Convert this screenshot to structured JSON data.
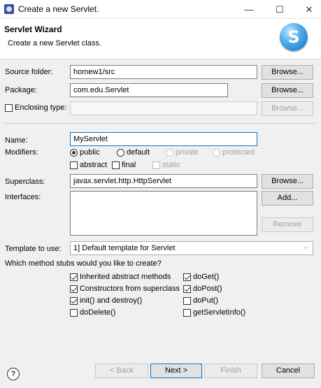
{
  "window": {
    "title": "Create a new Servlet.",
    "minimize": "—",
    "maximize": "☐",
    "close": "✕"
  },
  "header": {
    "title": "Servlet Wizard",
    "subtitle": "Create a new Servlet class.",
    "logo_letter": "S"
  },
  "form": {
    "source_folder": {
      "label": "Source folder:",
      "value": "homew1/src",
      "browse": "Browse..."
    },
    "package": {
      "label": "Package:",
      "value": "com.edu.Servlet",
      "browse": "Browse..."
    },
    "enclosing_type": {
      "label": "Enclosing type:",
      "value": "",
      "browse": "Browse...",
      "checked": false
    },
    "name": {
      "label": "Name:",
      "value": "MyServlet"
    },
    "modifiers": {
      "label": "Modifiers:",
      "public": "public",
      "default": "default",
      "private": "private",
      "protected": "protected",
      "selected": "public",
      "abstract": "abstract",
      "final": "final",
      "static": "static"
    },
    "superclass": {
      "label": "Superclass:",
      "value": "javax.servlet.http.HttpServlet",
      "browse": "Browse..."
    },
    "interfaces": {
      "label": "Interfaces:",
      "add": "Add...",
      "remove": "Remove",
      "items": []
    },
    "template": {
      "label": "Template to use:",
      "value": "1] Default template for Servlet"
    },
    "stubs": {
      "question": "Which method stubs would you like to create?",
      "inherited": {
        "label": "Inherited abstract methods",
        "checked": true
      },
      "constructors": {
        "label": "Constructors from superclass",
        "checked": true
      },
      "init_destroy": {
        "label": "init() and destroy()",
        "checked": true
      },
      "doDelete": {
        "label": "doDelete()",
        "checked": false
      },
      "doGet": {
        "label": "doGet()",
        "checked": true
      },
      "doPost": {
        "label": "doPost()",
        "checked": true
      },
      "doPut": {
        "label": "doPut()",
        "checked": false
      },
      "getServletInfo": {
        "label": "getServletInfo()",
        "checked": false
      }
    }
  },
  "footer": {
    "help": "?",
    "back": "< Back",
    "next": "Next >",
    "finish": "Finish",
    "cancel": "Cancel"
  }
}
